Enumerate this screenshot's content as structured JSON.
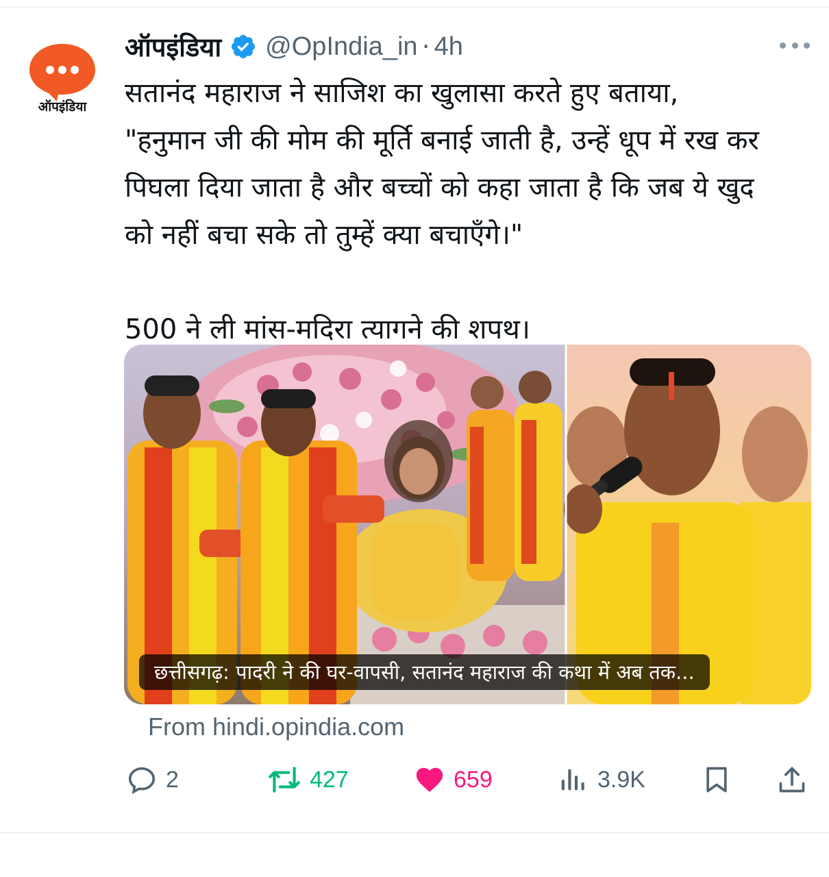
{
  "tweet": {
    "display_name": "ऑपइंडिया",
    "handle": "@OpIndia_in",
    "separator": "·",
    "time": "4h",
    "avatar_label": "ऑपइंडिया",
    "text_lines": [
      "सतानंद महाराज ने साजिश का खुलासा करते हुए बताया,",
      "\"हनुमान जी की मोम की मूर्ति बनाई जाती है, उन्हें धूप में रख कर",
      "पिघला दिया जाता है और बच्चों को कहा जाता है कि जब ये खुद",
      "को नहीं बचा सके तो तुम्हें क्या बचाएँगे।\""
    ],
    "text_para2": "500 ने ली मांस-मदिरा त्यागने की शपथ।",
    "card": {
      "caption": "छत्तीसगढ़: पादरी ने की घर-वापसी, सतानंद महाराज की कथा में अब तक...",
      "source": "From hindi.opindia.com"
    },
    "actions": {
      "replies": "2",
      "retweets": "427",
      "likes": "659",
      "views": "3.9K"
    }
  },
  "colors": {
    "brand_orange": "#f15a24",
    "verified_blue": "#1d9bf0",
    "retweet_green": "#00ba7c",
    "like_pink": "#f91880",
    "secondary_text": "#536471"
  },
  "icons": [
    "verified-badge-icon",
    "more-options-icon",
    "reply-icon",
    "retweet-icon",
    "like-icon",
    "views-icon",
    "bookmark-icon",
    "share-icon"
  ]
}
